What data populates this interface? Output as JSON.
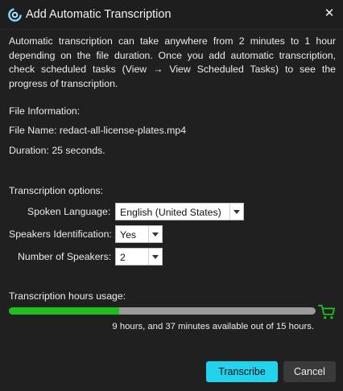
{
  "dialog": {
    "title": "Add Automatic Transcription",
    "close_glyph": "✕",
    "icon": "app-logo-icon"
  },
  "description": "Automatic transcription can take anywhere from 2 minutes to 1 hour depending on the file duration. Once you add automatic transcription, check scheduled tasks (View → View Scheduled Tasks) to see the progress of transcription.",
  "file_info": {
    "heading": "File Information:",
    "file_name": "File Name: redact-all-license-plates.mp4",
    "duration": "Duration: 25 seconds."
  },
  "options": {
    "heading": "Transcription options:",
    "spoken_language_label": "Spoken Language:",
    "spoken_language_value": "English (United States)",
    "speakers_identification_label": "Speakers Identification:",
    "speakers_identification_value": "Yes",
    "number_of_speakers_label": "Number of Speakers:",
    "number_of_speakers_value": "2"
  },
  "usage": {
    "heading": "Transcription hours usage:",
    "used_fraction": 0.36,
    "summary": "9 hours, and 37 minutes available out of 15 hours.",
    "bar_color": "#1fbf1f",
    "cart_icon": "shopping-cart-icon"
  },
  "buttons": {
    "transcribe": "Transcribe",
    "cancel": "Cancel"
  },
  "colors": {
    "accent": "#22d3ee",
    "background": "#202020"
  }
}
